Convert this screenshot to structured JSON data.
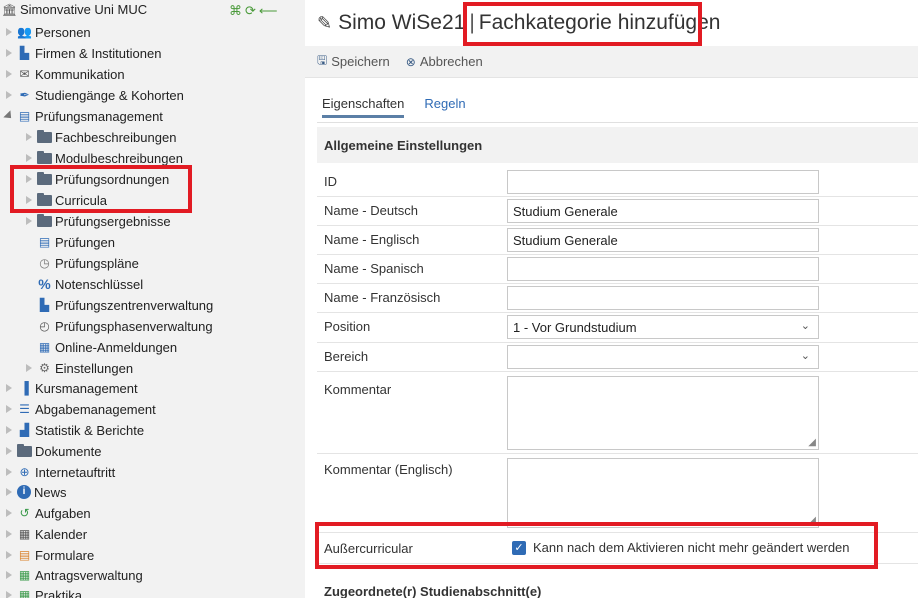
{
  "sidebar": {
    "root_title": "Simonvative Uni MUC",
    "items": [
      {
        "label": "Personen",
        "icon": "people-icon"
      },
      {
        "label": "Firmen & Institutionen",
        "icon": "building-icon"
      },
      {
        "label": "Kommunikation",
        "icon": "envelope-icon"
      },
      {
        "label": "Studiengänge & Kohorten",
        "icon": "quill-icon"
      },
      {
        "label": "Prüfungsmanagement",
        "icon": "exam-icon"
      },
      {
        "label": "Fachbeschreibungen",
        "icon": "folder-icon"
      },
      {
        "label": "Modulbeschreibungen",
        "icon": "folder-icon"
      },
      {
        "label": "Prüfungsordnungen",
        "icon": "folder-icon"
      },
      {
        "label": "Curricula",
        "icon": "folder-icon"
      },
      {
        "label": "Prüfungsergebnisse",
        "icon": "folder-icon"
      },
      {
        "label": "Prüfungen",
        "icon": "exam-icon"
      },
      {
        "label": "Prüfungspläne",
        "icon": "clock-icon"
      },
      {
        "label": "Notenschlüssel",
        "icon": "percent-icon"
      },
      {
        "label": "Prüfungszentrenverwaltung",
        "icon": "factory-icon"
      },
      {
        "label": "Prüfungsphasenverwaltung",
        "icon": "timer-icon"
      },
      {
        "label": "Online-Anmeldungen",
        "icon": "form-icon"
      },
      {
        "label": "Einstellungen",
        "icon": "gear-icon"
      },
      {
        "label": "Kursmanagement",
        "icon": "book-icon"
      },
      {
        "label": "Abgabemanagement",
        "icon": "list-icon"
      },
      {
        "label": "Statistik & Berichte",
        "icon": "bar-chart-icon"
      },
      {
        "label": "Dokumente",
        "icon": "folder-icon"
      },
      {
        "label": "Internetauftritt",
        "icon": "globe-icon"
      },
      {
        "label": "News",
        "icon": "info-icon"
      },
      {
        "label": "Aufgaben",
        "icon": "history-icon"
      },
      {
        "label": "Kalender",
        "icon": "calendar-icon"
      },
      {
        "label": "Formulare",
        "icon": "form-icon"
      },
      {
        "label": "Antragsverwaltung",
        "icon": "request-icon"
      },
      {
        "label": "Praktika",
        "icon": "request-icon"
      }
    ]
  },
  "header": {
    "context": "Simo WiSe21",
    "separator": "|",
    "title": "Fachkategorie hinzufügen"
  },
  "toolbar": {
    "save_label": "Speichern",
    "cancel_label": "Abbrechen"
  },
  "tabs": [
    {
      "label": "Eigenschaften",
      "active": true
    },
    {
      "label": "Regeln",
      "active": false
    }
  ],
  "section_general": "Allgemeine Einstellungen",
  "form": {
    "id": {
      "label": "ID",
      "value": ""
    },
    "name_de": {
      "label": "Name - Deutsch",
      "value": "Studium Generale"
    },
    "name_en": {
      "label": "Name - Englisch",
      "value": "Studium Generale"
    },
    "name_es": {
      "label": "Name - Spanisch",
      "value": ""
    },
    "name_fr": {
      "label": "Name - Französisch",
      "value": ""
    },
    "position": {
      "label": "Position",
      "value": "1 - Vor Grundstudium"
    },
    "bereich": {
      "label": "Bereich",
      "value": ""
    },
    "kommentar": {
      "label": "Kommentar",
      "value": ""
    },
    "kommentar_en": {
      "label": "Kommentar (Englisch)",
      "value": ""
    },
    "ausser": {
      "label": "Außercurricular",
      "checkbox_label": "Kann nach dem Aktivieren nicht mehr geändert werden",
      "checked": true
    }
  },
  "section_next": "Zugeordnete(r) Studienabschnitt(e)",
  "colors": {
    "highlight": "#e21b23",
    "accent": "#2f6bb5",
    "sidebar_bg": "#f2f2f2"
  }
}
